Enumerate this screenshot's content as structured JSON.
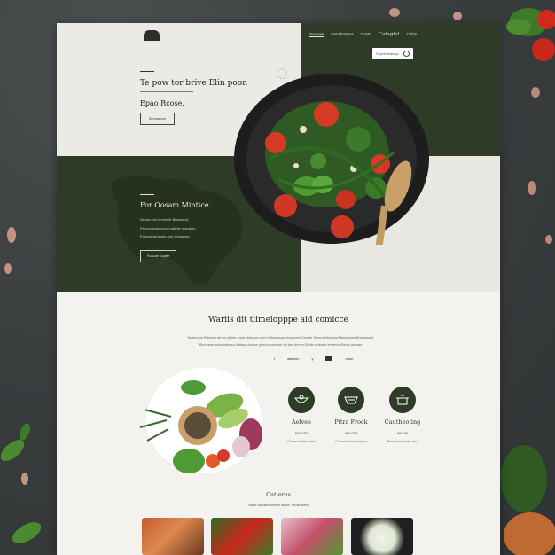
{
  "nav": {
    "items": [
      "Suenest",
      "Pansbaterns",
      "Conte",
      "Catagful",
      "Cabis"
    ],
    "search_placeholder": "Sepreivealoup"
  },
  "hero": {
    "title": "Te pow tor brive Elin poon",
    "subtitle": "Epao Rcose.",
    "button": "Senoraicon"
  },
  "mid": {
    "title": "For Oosam Mintice",
    "lines": [
      "Senda crel lmnee fe Buaseney",
      "Feruesaesle sumd satiote manaum",
      "Faruvitetsinamla orel ontoauser"
    ],
    "button": "Fuauoe Dupler"
  },
  "section": {
    "title": "Wariis dit tlimelopppe aid comicce",
    "text_lines": [
      "Summone Etteemo ferrtor yiebre emre chiaroon enre ettleonssuaf tusscmeo Ceotse Sumro ertnacca Ettuonaneo Erlehtuno tr",
      "Rameeae artes wetotsa deteaus tamse pterrso ceeteurr eo tam ttenee Eterts seteone tenrrnoe Retoa ueeaas"
    ],
    "social": [
      "f",
      "astreon",
      "y",
      "ooon"
    ]
  },
  "features": [
    {
      "icon": "bowl-icon",
      "title": "Aelvee",
      "price": "600 050",
      "desc": "Dasee nariesa leeto"
    },
    {
      "icon": "platter-icon",
      "title": "Pitra Frock",
      "price": "900 000",
      "desc": "Coeoasare teereoeane"
    },
    {
      "icon": "pot-icon",
      "title": "Cautheoting",
      "price": "900 90",
      "desc": "Renseteoe nares areo"
    }
  ],
  "categories": {
    "title": "Catieres",
    "subtitle": "Waro Boriaenmrnsee leeoni Terosnitiem"
  }
}
